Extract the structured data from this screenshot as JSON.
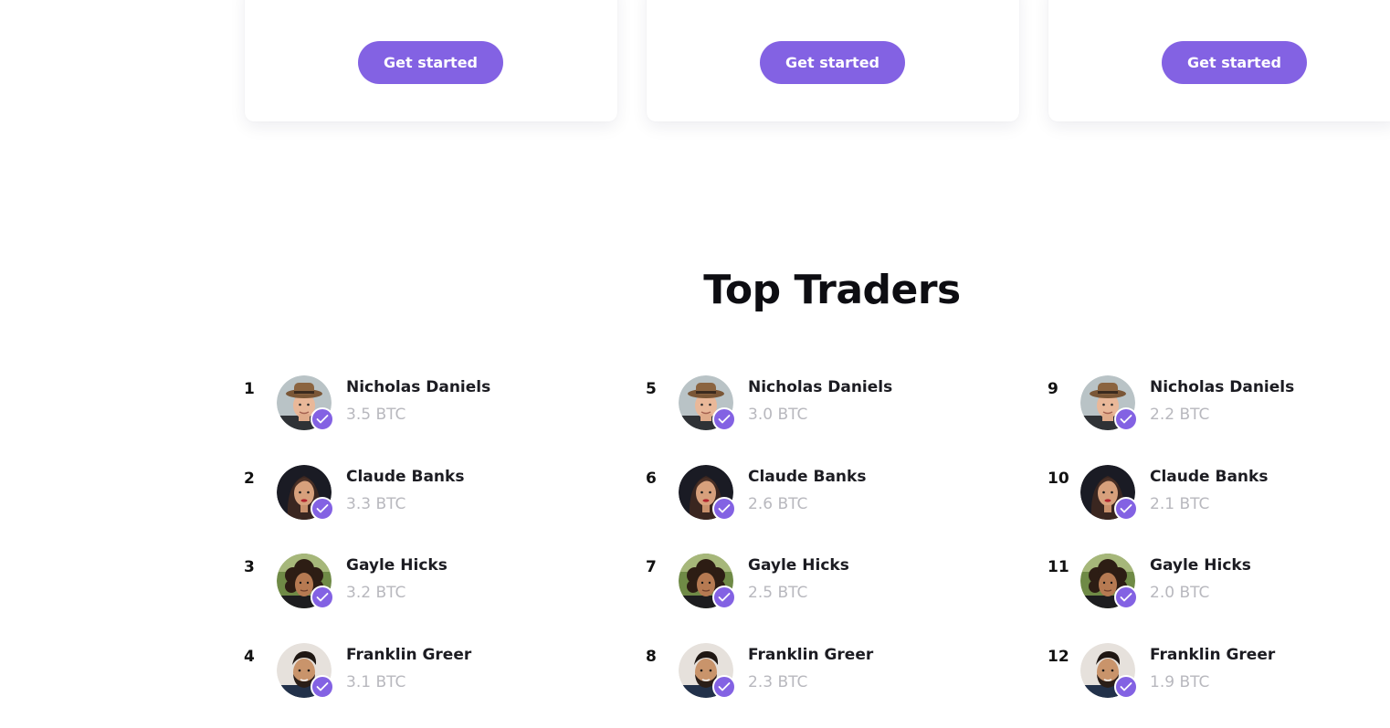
{
  "pricing_cards": [
    {
      "cta_label": "Get started"
    },
    {
      "cta_label": "Get started"
    },
    {
      "cta_label": "Get started"
    }
  ],
  "top_traders": {
    "title": "Top Traders",
    "columns": [
      [
        {
          "rank": "1",
          "name": "Nicholas Daniels",
          "amount": "3.5 BTC",
          "avatar": "avatar-man-hat"
        },
        {
          "rank": "2",
          "name": "Claude Banks",
          "amount": "3.3 BTC",
          "avatar": "avatar-woman-dark-hair"
        },
        {
          "rank": "3",
          "name": "Gayle Hicks",
          "amount": "3.2 BTC",
          "avatar": "avatar-curly-hair"
        },
        {
          "rank": "4",
          "name": "Franklin Greer",
          "amount": "3.1 BTC",
          "avatar": "avatar-man-beard"
        }
      ],
      [
        {
          "rank": "5",
          "name": "Nicholas Daniels",
          "amount": "3.0 BTC",
          "avatar": "avatar-man-hat"
        },
        {
          "rank": "6",
          "name": "Claude Banks",
          "amount": "2.6 BTC",
          "avatar": "avatar-woman-dark-hair"
        },
        {
          "rank": "7",
          "name": "Gayle Hicks",
          "amount": "2.5 BTC",
          "avatar": "avatar-curly-hair"
        },
        {
          "rank": "8",
          "name": "Franklin Greer",
          "amount": "2.3 BTC",
          "avatar": "avatar-man-beard"
        }
      ],
      [
        {
          "rank": "9",
          "name": "Nicholas Daniels",
          "amount": "2.2 BTC",
          "avatar": "avatar-man-hat"
        },
        {
          "rank": "10",
          "name": "Claude Banks",
          "amount": "2.1 BTC",
          "avatar": "avatar-woman-dark-hair"
        },
        {
          "rank": "11",
          "name": "Gayle Hicks",
          "amount": "2.0 BTC",
          "avatar": "avatar-curly-hair"
        },
        {
          "rank": "12",
          "name": "Franklin Greer",
          "amount": "1.9 BTC",
          "avatar": "avatar-man-beard"
        }
      ]
    ]
  },
  "colors": {
    "accent": "#8362e3",
    "muted_text": "#b8b8be",
    "heading": "#0d0d12"
  },
  "icons": {
    "verified": "check-icon"
  }
}
